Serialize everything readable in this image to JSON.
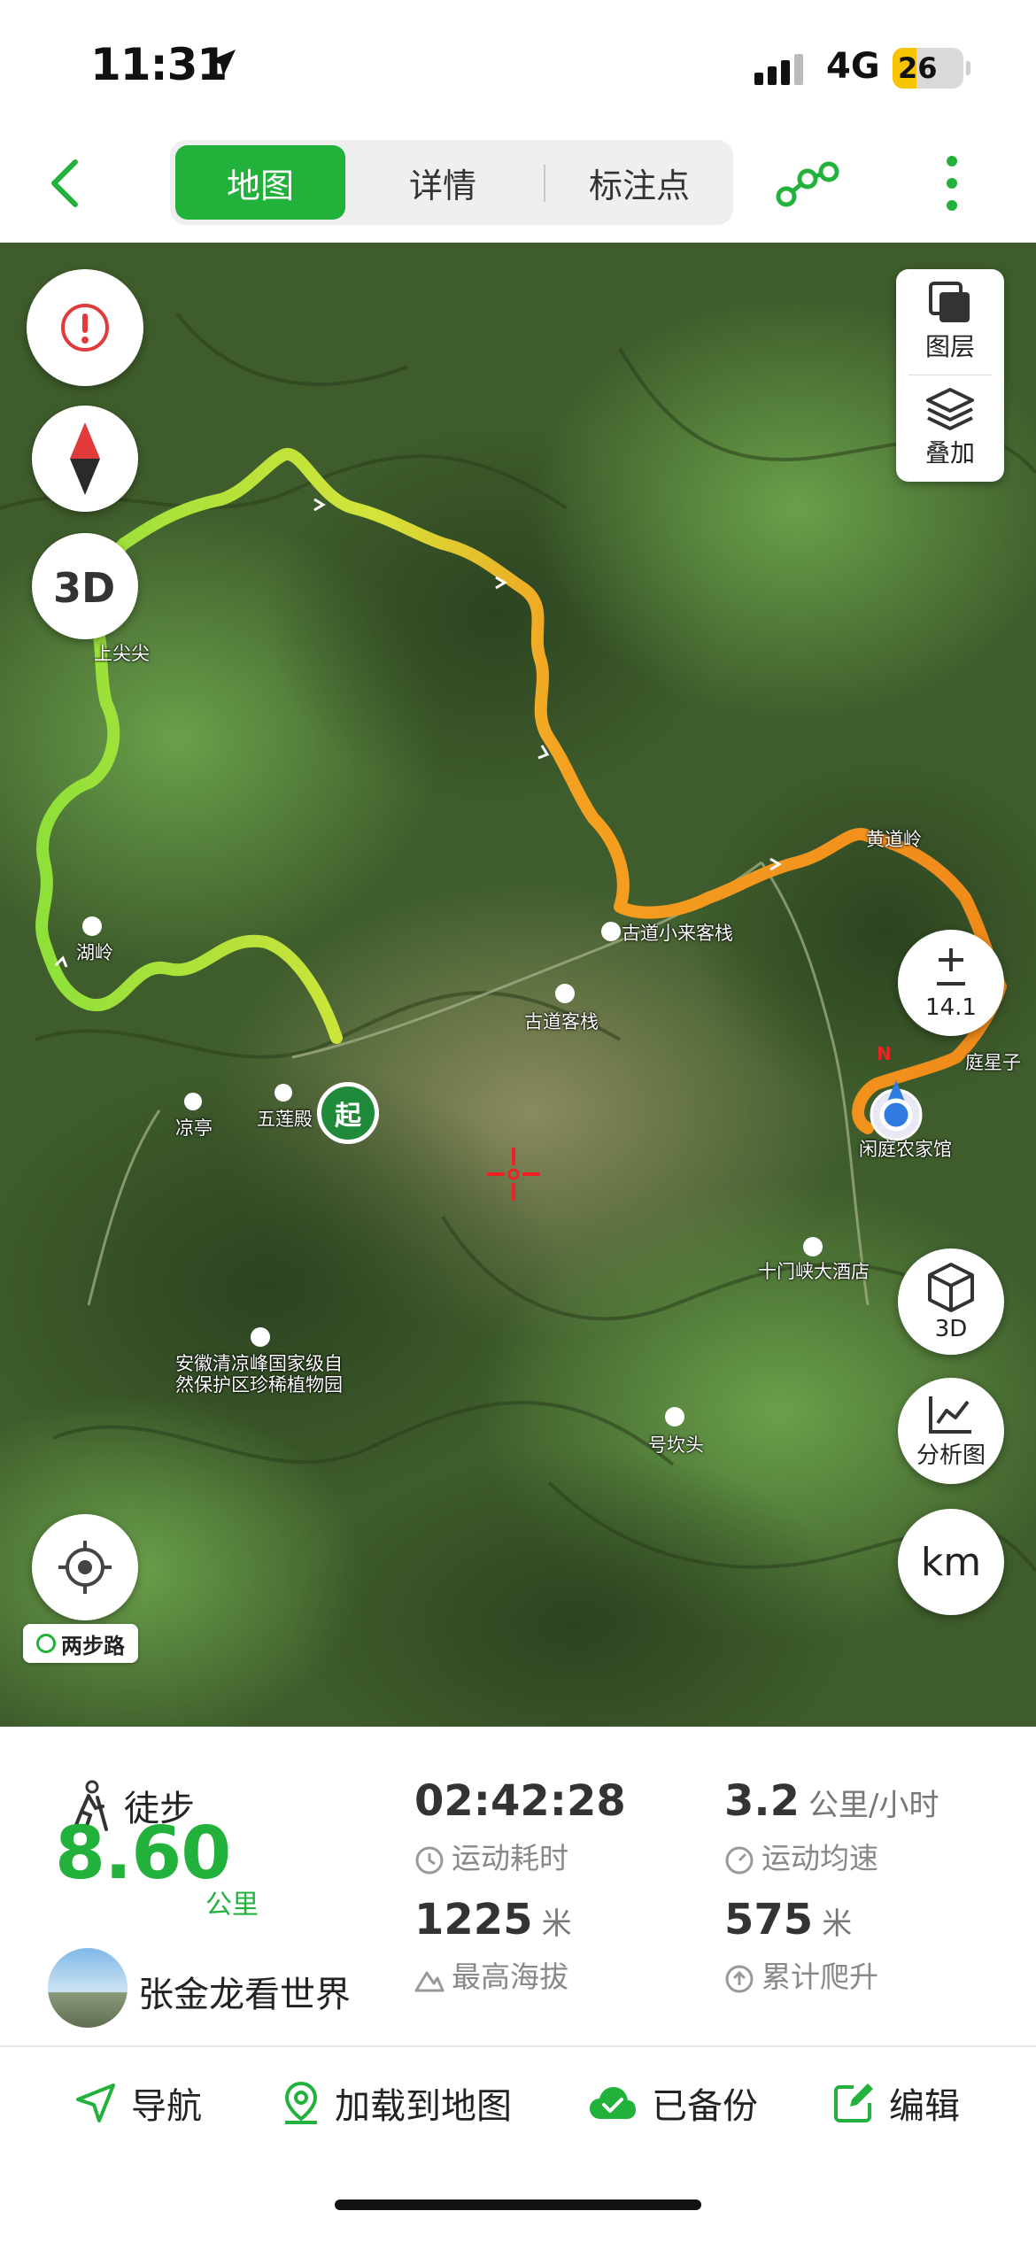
{
  "status_bar": {
    "time": "11:31",
    "network": "4G",
    "battery": "26"
  },
  "tabs": [
    {
      "label": "地图",
      "active": true
    },
    {
      "label": "详情",
      "active": false
    },
    {
      "label": "标注点",
      "active": false
    }
  ],
  "map": {
    "layers_label": "图层",
    "overlay_label": "叠加",
    "zoom_level": "14.1",
    "btn_3d_label": "3D",
    "analysis_label": "分析图",
    "unit_label": "km",
    "start_marker": "起",
    "north_marker": "N",
    "watermark": "两步路",
    "place_labels": {
      "p1": "古道客栈",
      "p2": "凉亭",
      "p3": "五莲殿",
      "p4": "十门峡大酒店",
      "p5": "号坎头",
      "p6": "闲庭农家馆",
      "p7": "安徽清凉峰国家级自然保护区珍稀植物园",
      "p8": "湖岭",
      "p9": "上尖尖",
      "p10": "古道小来客栈",
      "p11": "庭星子",
      "p12": "黄道岭"
    }
  },
  "stats": {
    "activity": "徒步",
    "distance": "8.60",
    "distance_unit": "公里",
    "user": "张金龙看世界",
    "duration": "02:42:28",
    "duration_label": "运动耗时",
    "avg_speed": "3.2",
    "avg_speed_unit": "公里/小时",
    "avg_speed_label": "运动均速",
    "max_alt": "1225",
    "max_alt_unit": "米",
    "max_alt_label": "最高海拔",
    "climb": "575",
    "climb_unit": "米",
    "climb_label": "累计爬升"
  },
  "actions": {
    "navigate": "导航",
    "load_to_map": "加载到地图",
    "backed_up": "已备份",
    "edit": "编辑"
  },
  "colors": {
    "accent": "#22b13a"
  }
}
